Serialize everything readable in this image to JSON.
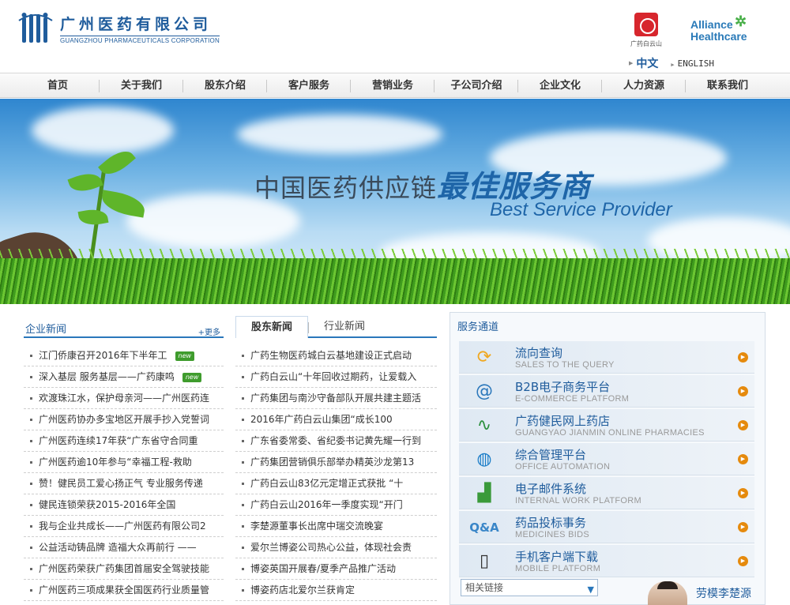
{
  "header": {
    "logo_cn": "广州医药有限公司",
    "logo_en": "GUANGZHOU PHARMACEUTICALS CORPORATION",
    "partner1_label": "广药白云山",
    "partner2_line1": "Alliance",
    "partner2_line2": "Healthcare",
    "lang_cn": "中文",
    "lang_en": "ENGLISH"
  },
  "nav": [
    "首页",
    "关于我们",
    "股东介绍",
    "客户服务",
    "营销业务",
    "子公司介绍",
    "企业文化",
    "人力资源",
    "联系我们"
  ],
  "banner": {
    "cn_prefix": "中国医药供应链",
    "cn_emph": "最佳服务商",
    "en": "Best Service Provider"
  },
  "company_news": {
    "title": "企业新闻",
    "more": "+更多",
    "new_badge": "new",
    "items": [
      {
        "text": "江门侨康召开2016年下半年工",
        "new": true
      },
      {
        "text": "深入基层 服务基层——广药康鸣",
        "new": true
      },
      {
        "text": "欢渡珠江水，保护母亲河——广州医药连",
        "new": false
      },
      {
        "text": "广州医药协办多宝地区开展手抄入党誓词",
        "new": false
      },
      {
        "text": "广州医药连续17年获“广东省守合同重",
        "new": false
      },
      {
        "text": "广州医药逾10年参与“幸福工程-救助",
        "new": false
      },
      {
        "text": "赞！健民员工爱心扬正气 专业服务传递",
        "new": false
      },
      {
        "text": "健民连锁荣获2015-2016年全国",
        "new": false
      },
      {
        "text": "我与企业共成长——广州医药有限公司2",
        "new": false
      },
      {
        "text": "公益活动铸品牌 造福大众再前行 ——",
        "new": false
      },
      {
        "text": "广州医药荣获广药集团首届安全驾驶技能",
        "new": false
      },
      {
        "text": "广州医药三项成果获全国医药行业质量管",
        "new": false
      }
    ]
  },
  "shareholder_news": {
    "tab_active": "股东新闻",
    "tab_inactive": "行业新闻",
    "items": [
      "广药生物医药城白云基地建设正式启动",
      "广药白云山“十年回收过期药，让爱载入",
      "广药集团与南沙守备部队开展共建主题活",
      "2016年广药白云山集团“成长100",
      "广东省委常委、省纪委书记黄先耀一行到",
      "广药集团营销俱乐部举办精英沙龙第13",
      "广药白云山83亿元定增正式获批 “十",
      "广药白云山2016年一季度实现“开门",
      "李楚源董事长出席中瑞交流晚宴",
      "爱尔兰博姿公司热心公益，体现社会责",
      "博姿英国开展春/夏季产品推广活动",
      "博姿药店北爱尔兰获肯定"
    ]
  },
  "services": {
    "title": "服务通道",
    "items": [
      {
        "cn": "流向查询",
        "en": "SALES TO THE QUERY",
        "icon": "refresh-icon"
      },
      {
        "cn": "B2B电子商务平台",
        "en": "E-COMMERCE PLATFORM",
        "icon": "at-icon"
      },
      {
        "cn": "广药健民网上药店",
        "en": "GUANGYAO JIANMIN ONLINE PHARMACIES",
        "icon": "wave-icon"
      },
      {
        "cn": "综合管理平台",
        "en": "OFFICE AUTOMATION",
        "icon": "globe-icon"
      },
      {
        "cn": "电子邮件系统",
        "en": "INTERNAL WORK PLATFORM",
        "icon": "chart-icon"
      },
      {
        "cn": "药品投标事务",
        "en": "MEDICINES BIDS",
        "icon": "qa-icon"
      },
      {
        "cn": "手机客户端下载",
        "en": "MOBILE PLATFORM",
        "icon": "phone-icon"
      }
    ],
    "select_label": "相关链接",
    "person_label": "劳模李楚源"
  }
}
